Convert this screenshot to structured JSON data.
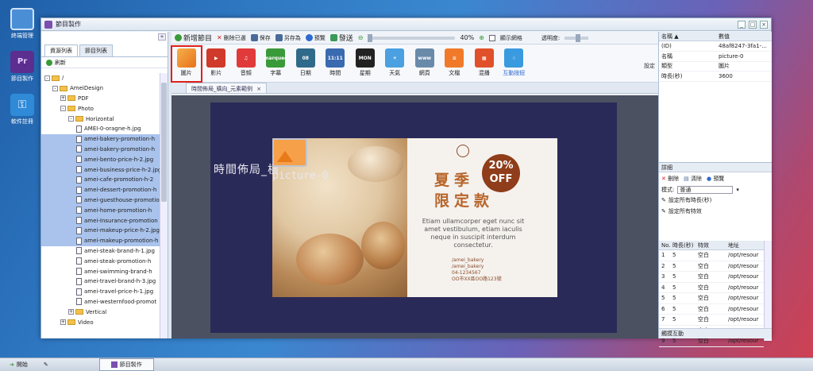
{
  "desktop": {
    "icons": [
      {
        "label": "終端管理",
        "icon": "monitor-icon",
        "color": "#4a8fd6"
      },
      {
        "label": "節目製作",
        "icon": "premiere-icon",
        "color": "#5b2e8f"
      },
      {
        "label": "軟件註冊",
        "icon": "key-icon",
        "color": "#2f8ad8"
      }
    ]
  },
  "window": {
    "title": "節目製作",
    "controls": [
      "_",
      "□",
      "×"
    ]
  },
  "left_panel": {
    "collapse": "«",
    "tabs": [
      "資源列表",
      "節目列表"
    ],
    "refresh": "刷新",
    "tree": [
      {
        "label": "/",
        "indent": 0,
        "type": "folder",
        "exp": "-",
        "selected": false
      },
      {
        "label": "AmeiDesign",
        "indent": 1,
        "type": "folder",
        "exp": "-",
        "selected": false
      },
      {
        "label": "PDF",
        "indent": 2,
        "type": "folder",
        "exp": "+",
        "selected": false
      },
      {
        "label": "Photo",
        "indent": 2,
        "type": "folder",
        "exp": "-",
        "selected": false
      },
      {
        "label": "Horizontal",
        "indent": 3,
        "type": "folder",
        "exp": "-",
        "selected": false
      },
      {
        "label": "AMEI-0-oragne-h.jpg",
        "indent": 4,
        "type": "file",
        "selected": false
      },
      {
        "label": "amei-bakery-promotion-h",
        "indent": 4,
        "type": "file",
        "selected": true
      },
      {
        "label": "amei-bakery-promotion-h",
        "indent": 4,
        "type": "file",
        "selected": true
      },
      {
        "label": "amei-bento-price-h-2.jpg",
        "indent": 4,
        "type": "file",
        "selected": true
      },
      {
        "label": "amei-business-price-h-2.jpg",
        "indent": 4,
        "type": "file",
        "selected": true
      },
      {
        "label": "amei-cafe-promotion-h-2",
        "indent": 4,
        "type": "file",
        "selected": true
      },
      {
        "label": "amei-dessert-promotion-h",
        "indent": 4,
        "type": "file",
        "selected": true
      },
      {
        "label": "amei-guesthouse-promotion",
        "indent": 4,
        "type": "file",
        "selected": true
      },
      {
        "label": "amei-home-promotion-h",
        "indent": 4,
        "type": "file",
        "selected": true
      },
      {
        "label": "amei-Insurance-promotion",
        "indent": 4,
        "type": "file",
        "selected": true
      },
      {
        "label": "amei-makeup-price-h-2.jpg",
        "indent": 4,
        "type": "file",
        "selected": true
      },
      {
        "label": "amei-makeup-promotion-h",
        "indent": 4,
        "type": "file",
        "selected": true
      },
      {
        "label": "amei-steak-brand-h-1.jpg",
        "indent": 4,
        "type": "file",
        "selected": false
      },
      {
        "label": "amei-steak-promotion-h",
        "indent": 4,
        "type": "file",
        "selected": false
      },
      {
        "label": "amei-swimming-brand-h",
        "indent": 4,
        "type": "file",
        "selected": false
      },
      {
        "label": "amei-travel-brand-h-3.jpg",
        "indent": 4,
        "type": "file",
        "selected": false
      },
      {
        "label": "amei-travel-price-h-1.jpg",
        "indent": 4,
        "type": "file",
        "selected": false
      },
      {
        "label": "amei-westernfood-promot",
        "indent": 4,
        "type": "file",
        "selected": false
      },
      {
        "label": "Vertical",
        "indent": 3,
        "type": "folder",
        "exp": "+",
        "selected": false
      },
      {
        "label": "Video",
        "indent": 2,
        "type": "folder",
        "exp": "+",
        "selected": false
      }
    ]
  },
  "toolbar": {
    "new_program": "新增節目",
    "delete": "刪除已選",
    "save": "保存",
    "save_as": "另存為",
    "preview": "預覽",
    "send": "發送",
    "zoom": "40%",
    "show_grid": "顯示網格",
    "transparency": "透明度:"
  },
  "palette": [
    {
      "label": "圖片",
      "color": "#f08a2a",
      "glyph": "",
      "selected": true
    },
    {
      "label": "影片",
      "color": "#d03a2a",
      "glyph": "▶",
      "selected": false
    },
    {
      "label": "音頻",
      "color": "#e03a3a",
      "glyph": "♫",
      "selected": false
    },
    {
      "label": "字幕",
      "color": "#3a9a3a",
      "glyph": "marquee",
      "selected": false
    },
    {
      "label": "日期",
      "color": "#2f6a8a",
      "glyph": "08",
      "selected": false
    },
    {
      "label": "時間",
      "color": "#3a6ab0",
      "glyph": "11:11",
      "selected": false
    },
    {
      "label": "星期",
      "color": "#222222",
      "glyph": "MON",
      "selected": false
    },
    {
      "label": "天氣",
      "color": "#4aa0e0",
      "glyph": "☀",
      "selected": false
    },
    {
      "label": "網頁",
      "color": "#6a8aaa",
      "glyph": "www",
      "selected": false
    },
    {
      "label": "文檔",
      "color": "#f07a2a",
      "glyph": "≡",
      "selected": false
    },
    {
      "label": "混播",
      "color": "#e0502a",
      "glyph": "▦",
      "selected": false
    },
    {
      "label": "互動按鈕",
      "color": "#3a9ae0",
      "glyph": "☝",
      "selected": false
    }
  ],
  "settings_label": "設定",
  "doc_tab": "時間佈局_橫向_元素範例",
  "doc_tab_close": "×",
  "stage": {
    "layout_label": "時間佈局_橫",
    "picture_name": "picture-0"
  },
  "poster": {
    "badge_line1": "20%",
    "badge_line2": "OFF",
    "title1": "夏季",
    "title2": "限定款",
    "desc": "Etiam ullamcorper eget nunc sit amet vestibulum, etiam iaculis neque in suscipit interdum consectetur.",
    "contact1": "/amei_bakery",
    "contact2": "/amei_bakery",
    "contact3": "04-1234567",
    "contact4": "OO市XX區OO路123號"
  },
  "properties": {
    "headers": [
      "名稱 ▲",
      "數值"
    ],
    "rows": [
      {
        "name": "(ID)",
        "value": "48af8247-3fa1-..."
      },
      {
        "name": "名稱",
        "value": "picture-0"
      },
      {
        "name": "類型",
        "value": "圖片"
      },
      {
        "name": "時長(秒)",
        "value": "3600"
      }
    ]
  },
  "details": {
    "title": "詳細",
    "delete": "刪除",
    "clear": "清除",
    "preview": "預覽",
    "mode_label": "模式:",
    "mode_value": "普通",
    "set_duration": "設定所有時長(秒)",
    "set_effect": "設定所有特效",
    "headers": [
      "No.",
      "時長(秒)",
      "特效",
      "地址"
    ],
    "rows": [
      {
        "no": "1",
        "dur": "5",
        "fx": "空白",
        "path": "/opt/resour"
      },
      {
        "no": "2",
        "dur": "5",
        "fx": "空白",
        "path": "/opt/resour"
      },
      {
        "no": "3",
        "dur": "5",
        "fx": "空白",
        "path": "/opt/resour"
      },
      {
        "no": "4",
        "dur": "5",
        "fx": "空白",
        "path": "/opt/resour"
      },
      {
        "no": "5",
        "dur": "5",
        "fx": "空白",
        "path": "/opt/resour"
      },
      {
        "no": "6",
        "dur": "5",
        "fx": "空白",
        "path": "/opt/resour"
      },
      {
        "no": "7",
        "dur": "5",
        "fx": "空白",
        "path": "/opt/resour"
      },
      {
        "no": "8",
        "dur": "5",
        "fx": "空白",
        "path": "/opt/resour"
      },
      {
        "no": "9",
        "dur": "5",
        "fx": "空白",
        "path": "/opt/resour"
      }
    ],
    "footer": "觸摸互動"
  },
  "taskbar": {
    "start": "開始",
    "task": "節目製作"
  }
}
